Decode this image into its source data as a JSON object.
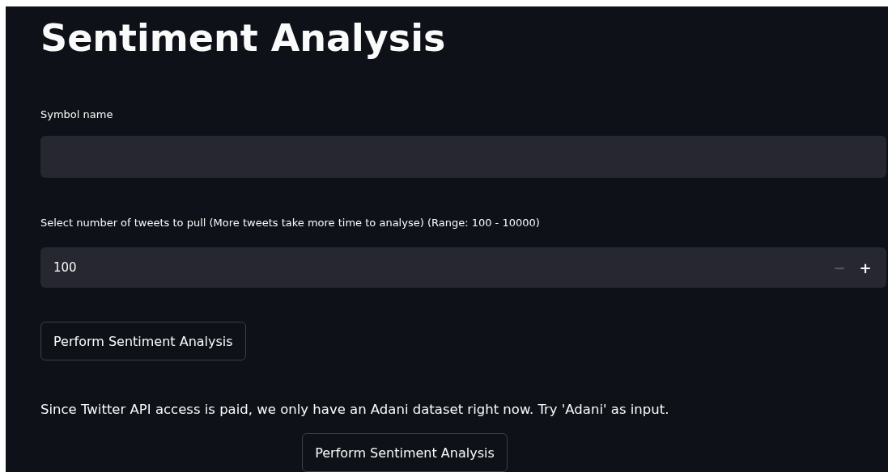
{
  "title": "Sentiment Analysis",
  "symbol_field": {
    "label": "Symbol name"
  },
  "tweets_field": {
    "label": "Select number of tweets to pull (More tweets take more time to analyse) (Range: 100 - 10000)",
    "value": "100",
    "steppers": [
      {
        "symbol": "−",
        "disabled": true
      },
      {
        "symbol": "+",
        "disabled": false
      }
    ]
  },
  "buttons": [
    "Perform Sentiment Analysis"
  ],
  "note": "Since Twitter API access is paid, we only have an Adani dataset right now. Try 'Adani' as input.",
  "centered_buttons": [
    "Perform Sentiment Analysis"
  ]
}
